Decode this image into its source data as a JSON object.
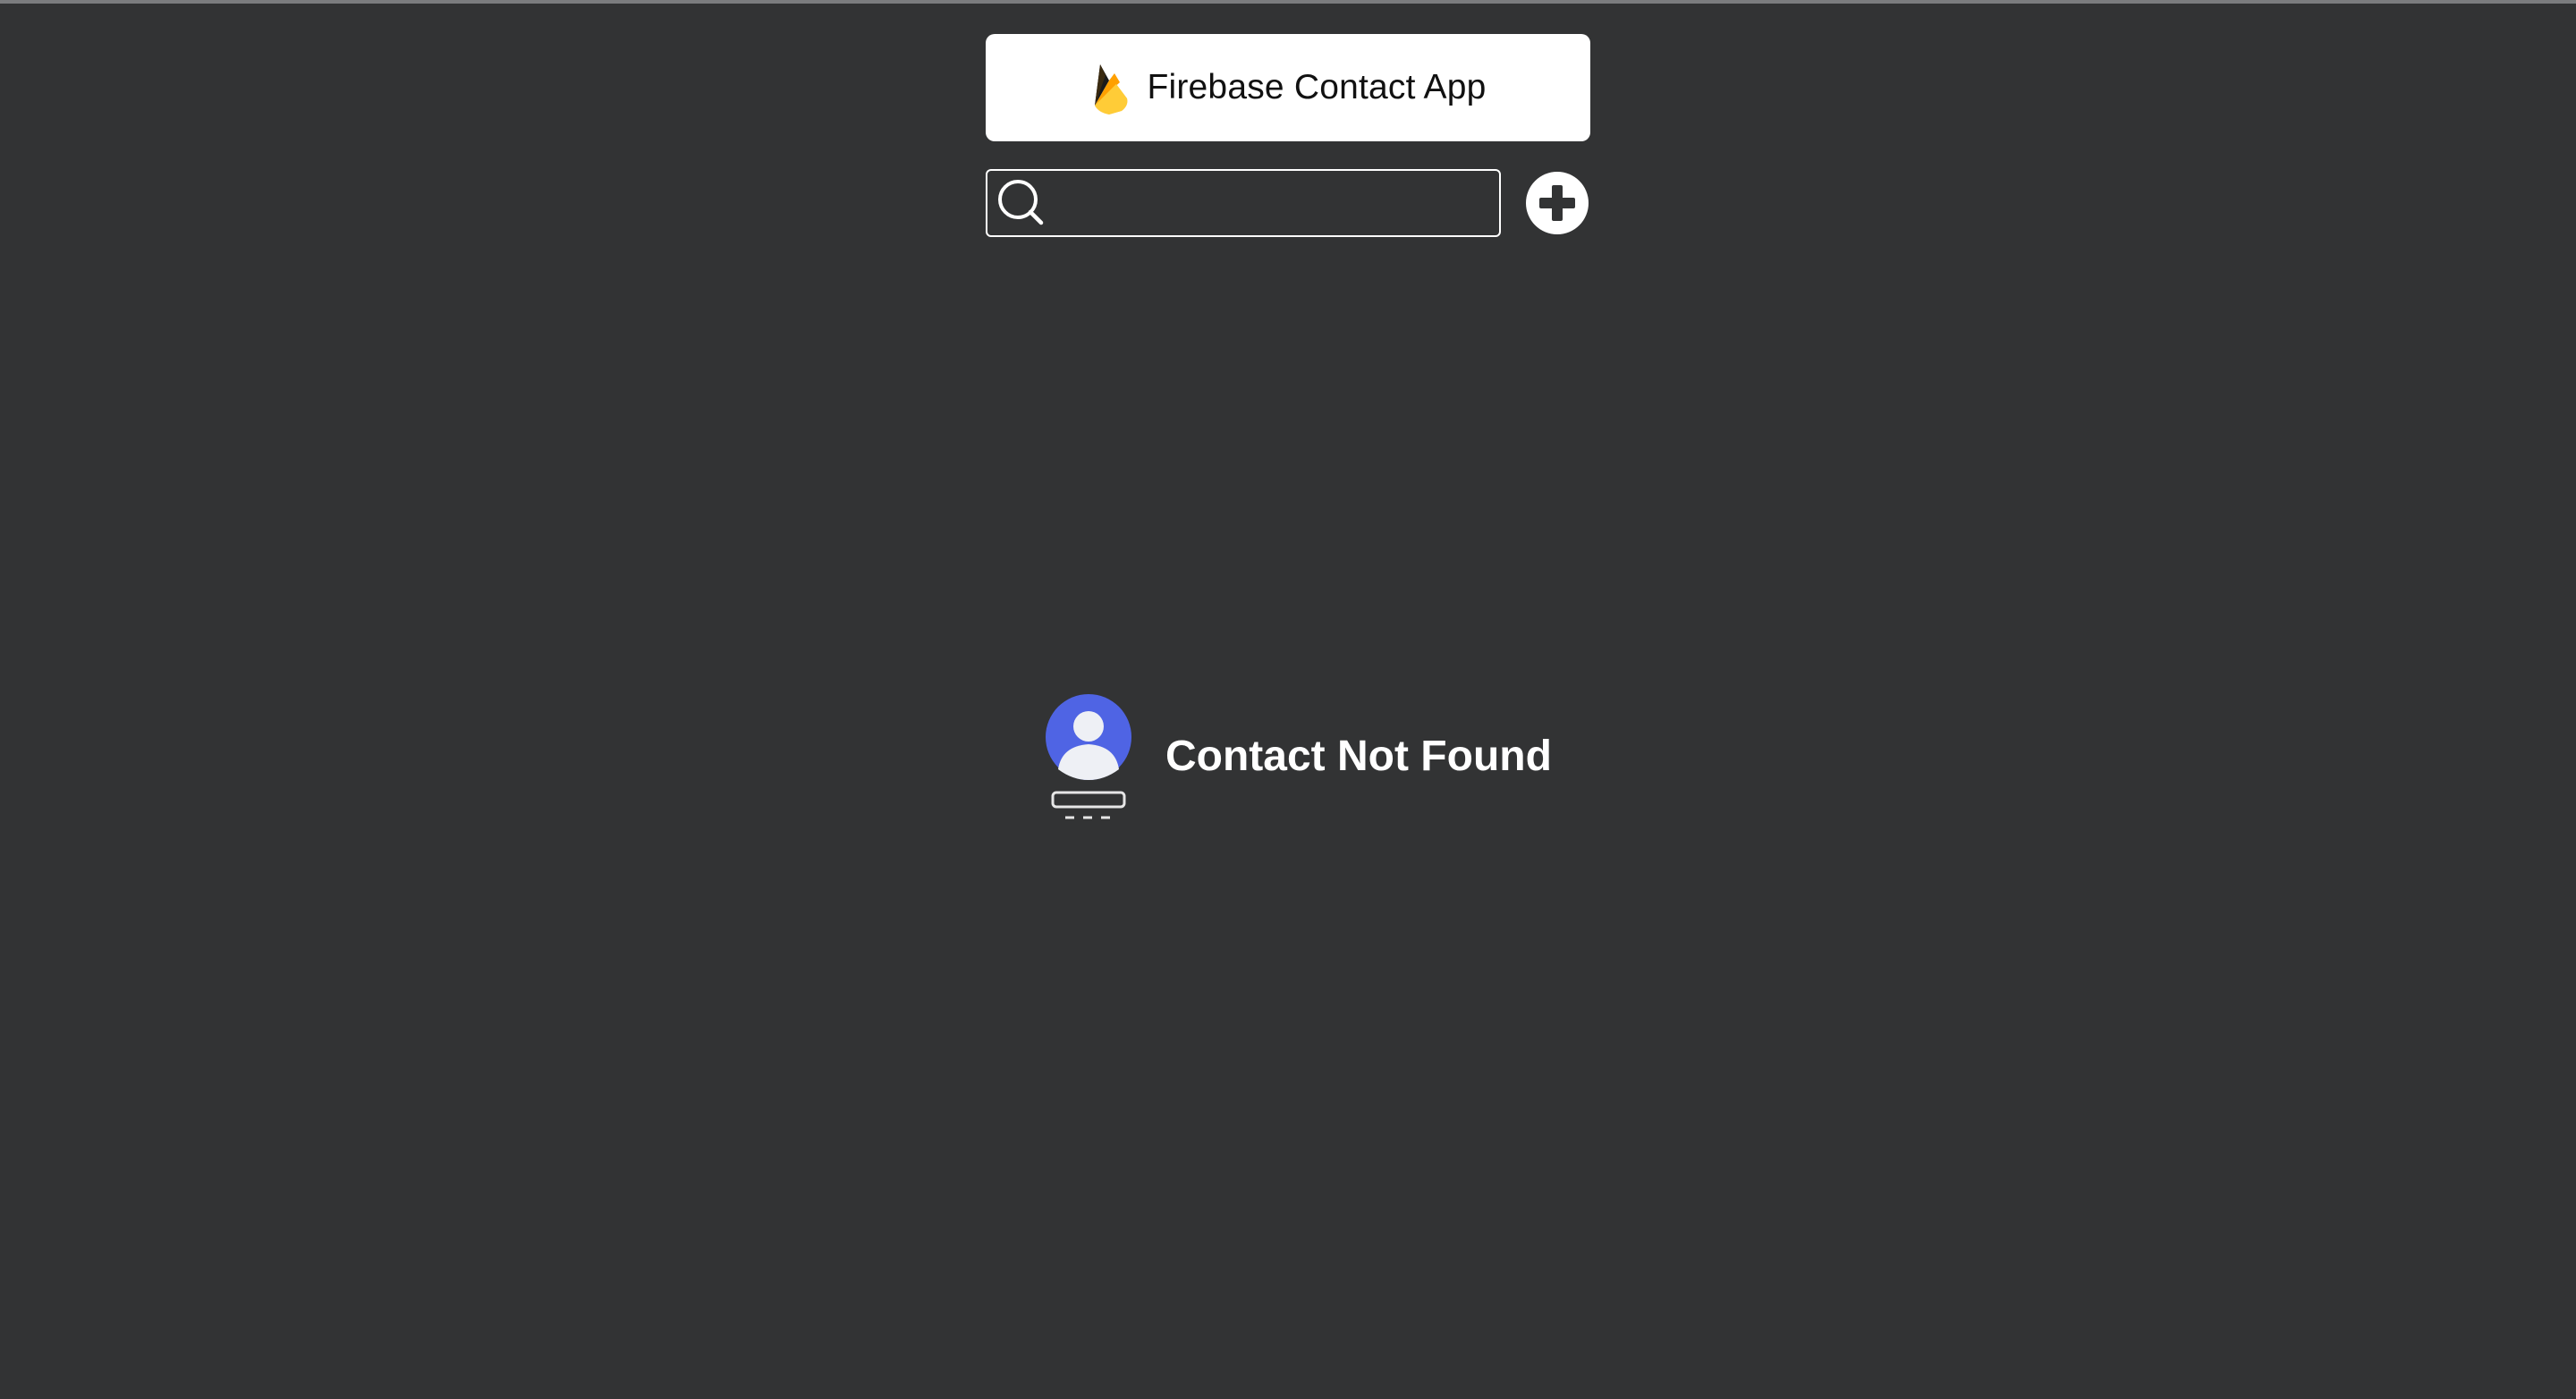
{
  "header": {
    "logo_icon": "firebase-flame-icon",
    "title": "Firebase Contact App"
  },
  "search": {
    "icon": "search-icon",
    "value": "",
    "placeholder": ""
  },
  "toolbar": {
    "add_icon": "plus-circle-icon"
  },
  "empty_state": {
    "illustration": "contact-avatar-illustration",
    "message": "Contact Not Found"
  },
  "colors": {
    "background": "#323334",
    "header_background": "#ffffff",
    "avatar_blue": "#4f64e4",
    "flame_amber": "#ffca28",
    "flame_yellow": "#ffe082",
    "text_light": "#ffffff",
    "text_dark": "#111111"
  }
}
